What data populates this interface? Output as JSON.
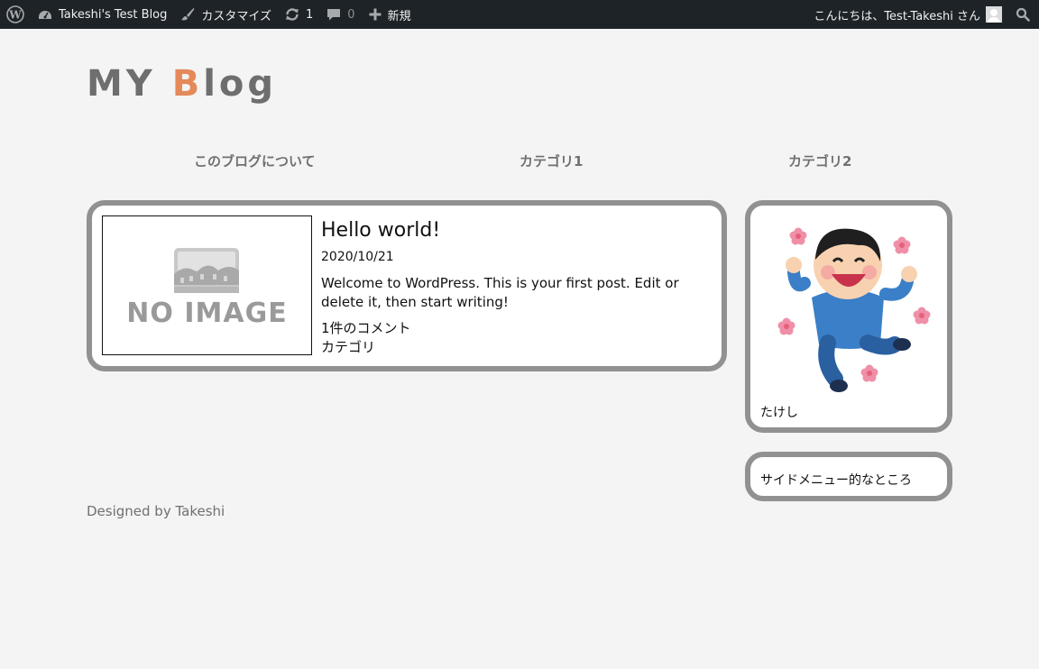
{
  "admin_bar": {
    "site_name": "Takeshi's Test Blog",
    "customize": "カスタマイズ",
    "updates_count": "1",
    "comments_count": "0",
    "new_label": "新規",
    "greeting": "こんにちは、Test-Takeshi さん"
  },
  "site": {
    "title_part1": "MY ",
    "title_accent": "B",
    "title_part2": "log"
  },
  "nav": {
    "items": [
      {
        "label": "このブログについて"
      },
      {
        "label": "カテゴリ1"
      },
      {
        "label": "カテゴリ2"
      }
    ]
  },
  "post": {
    "thumbnail_text": "NO IMAGE",
    "title": "Hello world!",
    "date": "2020/10/21",
    "excerpt": "Welcome to WordPress. This is your first post. Edit or delete it, then start writing!",
    "comments": "1件のコメント",
    "category": "カテゴリ"
  },
  "sidebar": {
    "profile_name": "たけし",
    "menu_text": "サイドメニュー的なところ"
  },
  "footer": {
    "text": "Designed by Takeshi"
  },
  "colors": {
    "admin_bar_bg": "#1d2327",
    "title_accent": "#e5895a",
    "card_border": "#919191",
    "page_bg": "#f4f4f4"
  }
}
